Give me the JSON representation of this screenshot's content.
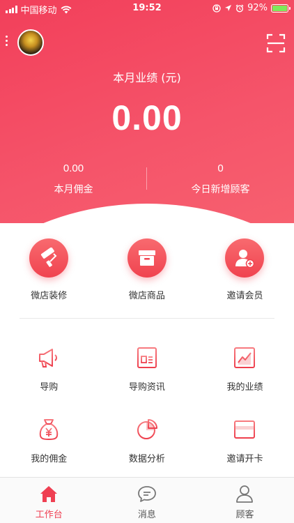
{
  "status_bar": {
    "carrier": "中国移动",
    "time": "19:52",
    "battery": "92%"
  },
  "header": {
    "title": "本月业绩 (元)",
    "amount": "0.00",
    "stats": [
      {
        "value": "0.00",
        "label": "本月佣金"
      },
      {
        "value": "0",
        "label": "今日新增顾客"
      }
    ]
  },
  "quick_actions": [
    {
      "label": "微店装修",
      "icon": "paint-roller-icon"
    },
    {
      "label": "微店商品",
      "icon": "box-icon"
    },
    {
      "label": "邀请会员",
      "icon": "add-user-icon"
    }
  ],
  "grid": [
    {
      "label": "导购",
      "icon": "megaphone-icon"
    },
    {
      "label": "导购资讯",
      "icon": "news-icon"
    },
    {
      "label": "我的业绩",
      "icon": "chart-icon"
    },
    {
      "label": "我的佣金",
      "icon": "money-bag-icon"
    },
    {
      "label": "数据分析",
      "icon": "pie-chart-icon"
    },
    {
      "label": "邀请开卡",
      "icon": "card-icon"
    }
  ],
  "tabbar": [
    {
      "label": "工作台",
      "icon": "home-icon",
      "active": true
    },
    {
      "label": "消息",
      "icon": "message-icon",
      "active": false
    },
    {
      "label": "顾客",
      "icon": "user-icon",
      "active": false
    }
  ],
  "colors": {
    "brand": "#f23f5a",
    "accent": "#ef3f52"
  }
}
